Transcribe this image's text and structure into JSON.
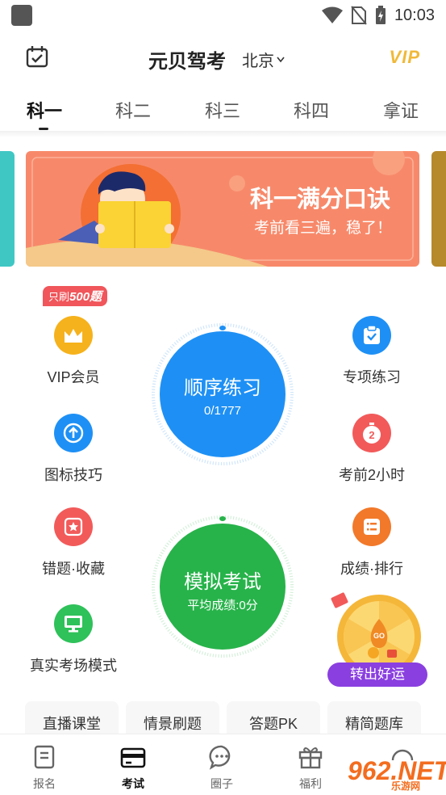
{
  "status": {
    "time": "10:03"
  },
  "header": {
    "title": "元贝驾考",
    "city": "北京",
    "vip_label": "VIP"
  },
  "tabs": [
    {
      "label": "科一",
      "active": true
    },
    {
      "label": "科二",
      "active": false
    },
    {
      "label": "科三",
      "active": false
    },
    {
      "label": "科四",
      "active": false
    },
    {
      "label": "拿证",
      "active": false
    }
  ],
  "banner": {
    "title": "科一满分口诀",
    "subtitle": "考前看三遍，稳了！"
  },
  "promo_tag": {
    "prefix": "只刷",
    "number": "500题"
  },
  "left_items": [
    {
      "label": "VIP会员",
      "icon": "crown-icon",
      "color": "#f6b21c"
    },
    {
      "label": "图标技巧",
      "icon": "arrow-up-icon",
      "color": "#1e90f5"
    },
    {
      "label": "错题·收藏",
      "icon": "star-icon",
      "color": "#f25a5a"
    },
    {
      "label": "真实考场模式",
      "icon": "monitor-icon",
      "color": "#2fc15a"
    }
  ],
  "right_items": [
    {
      "label": "专项练习",
      "icon": "clipboard-icon",
      "color": "#1e90f5"
    },
    {
      "label": "考前2小时",
      "icon": "timer-icon",
      "color": "#f25a5a"
    },
    {
      "label": "成绩·排行",
      "icon": "list-icon",
      "color": "#f2792a"
    }
  ],
  "practice_circle": {
    "title": "顺序练习",
    "progress": "0/1777",
    "color": "#1e90f5"
  },
  "exam_circle": {
    "title": "模拟考试",
    "score": "平均成绩:0分",
    "color": "#27b34a"
  },
  "lucky_wheel": {
    "button": "转出好运",
    "go_label": "GO"
  },
  "chips": [
    {
      "label": "直播课堂"
    },
    {
      "label": "情景刷题"
    },
    {
      "label": "答题PK"
    },
    {
      "label": "精简题库"
    }
  ],
  "nav": [
    {
      "label": "报名",
      "icon": "document-icon",
      "active": false
    },
    {
      "label": "考试",
      "icon": "wallet-icon",
      "active": true
    },
    {
      "label": "圈子",
      "icon": "chat-icon",
      "active": false
    },
    {
      "label": "福利",
      "icon": "gift-icon",
      "active": false
    }
  ],
  "watermark": {
    "text": "962.NET",
    "sub": "乐游网"
  }
}
